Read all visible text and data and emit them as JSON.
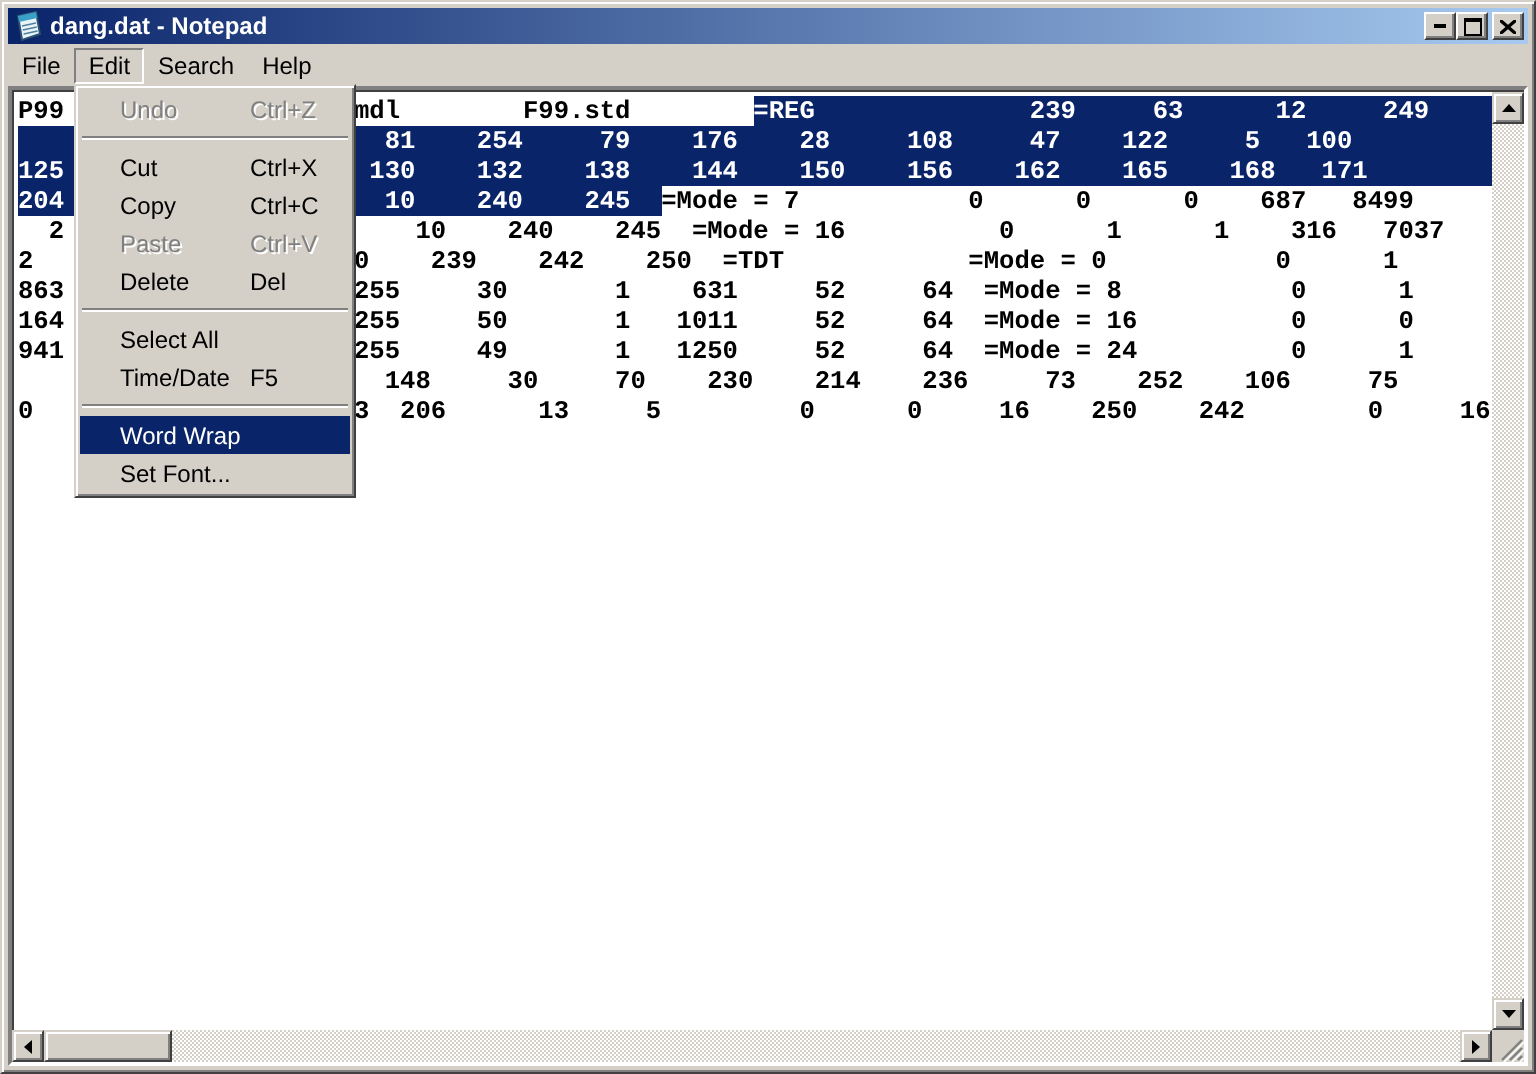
{
  "window": {
    "title": "dang.dat - Notepad"
  },
  "menu_bar": [
    {
      "label": "File",
      "selected": false
    },
    {
      "label": "Edit",
      "selected": true
    },
    {
      "label": "Search",
      "selected": false
    },
    {
      "label": "Help",
      "selected": false
    }
  ],
  "edit_menu": [
    {
      "kind": "item",
      "label": "Undo",
      "shortcut": "Ctrl+Z",
      "disabled": true,
      "selected": false
    },
    {
      "kind": "separator"
    },
    {
      "kind": "item",
      "label": "Cut",
      "shortcut": "Ctrl+X",
      "disabled": false,
      "selected": false
    },
    {
      "kind": "item",
      "label": "Copy",
      "shortcut": "Ctrl+C",
      "disabled": false,
      "selected": false
    },
    {
      "kind": "item",
      "label": "Paste",
      "shortcut": "Ctrl+V",
      "disabled": true,
      "selected": false
    },
    {
      "kind": "item",
      "label": "Delete",
      "shortcut": "Del",
      "disabled": false,
      "selected": false
    },
    {
      "kind": "separator"
    },
    {
      "kind": "item",
      "label": "Select All",
      "disabled": false,
      "selected": false
    },
    {
      "kind": "item",
      "label": "Time/Date",
      "shortcut": "F5",
      "disabled": false,
      "selected": false
    },
    {
      "kind": "separator"
    },
    {
      "kind": "item",
      "label": "Word Wrap",
      "disabled": false,
      "selected": true
    },
    {
      "kind": "item",
      "label": "Set Font...",
      "disabled": false,
      "selected": false
    }
  ],
  "editor": {
    "lines": [
      {
        "left": {
          "text": "P99",
          "selected": false
        },
        "right": [
          {
            "text": "mdl        F99.std        ",
            "selected": false
          },
          {
            "text": "=REG              239     63      12     249",
            "selected": true
          }
        ]
      },
      {
        "left": {
          "selected": true
        },
        "right": [
          {
            "text": "  81    254     79    176    28     108     47    122     5   100",
            "selected": true
          }
        ]
      },
      {
        "left": {
          "text": "125",
          "selected": true
        },
        "right": [
          {
            "text": " 130    132    138    144    150    156    162    165    168   171",
            "selected": true
          }
        ]
      },
      {
        "left": {
          "text": "204",
          "selected": true
        },
        "right": [
          {
            "text": "  10    240    245  ",
            "selected": true
          },
          {
            "text": "=Mode = 7           0      0      0    687   8499",
            "selected": false
          }
        ]
      },
      {
        "left": {
          "text": "  2",
          "selected": false
        },
        "right": [
          {
            "text": "    10    240    245  =Mode = 16          0      1      1    316   7037",
            "selected": false
          }
        ]
      },
      {
        "left": {
          "text": "2",
          "selected": false
        },
        "right": [
          {
            "text": "0    239    242    250  =TDT            =Mode = 0           0      1",
            "selected": false
          }
        ]
      },
      {
        "left": {
          "text": "863",
          "selected": false
        },
        "right": [
          {
            "text": "255     30       1    631     52     64  =Mode = 8           0      1",
            "selected": false
          }
        ]
      },
      {
        "left": {
          "text": "164",
          "selected": false
        },
        "right": [
          {
            "text": "255     50       1   1011     52     64  =Mode = 16          0      0",
            "selected": false
          }
        ]
      },
      {
        "left": {
          "text": "941",
          "selected": false
        },
        "right": [
          {
            "text": "255     49       1   1250     52     64  =Mode = 24          0      1",
            "selected": false
          }
        ]
      },
      {
        "right": [
          {
            "text": "  148     30     70    230    214    236     73    252    106     75",
            "selected": false
          }
        ]
      },
      {
        "left": {
          "text": "0",
          "selected": false
        },
        "right": [
          {
            "text": "3  206      13     5         0      0     16    250    242        0     16",
            "selected": false
          }
        ]
      }
    ]
  }
}
